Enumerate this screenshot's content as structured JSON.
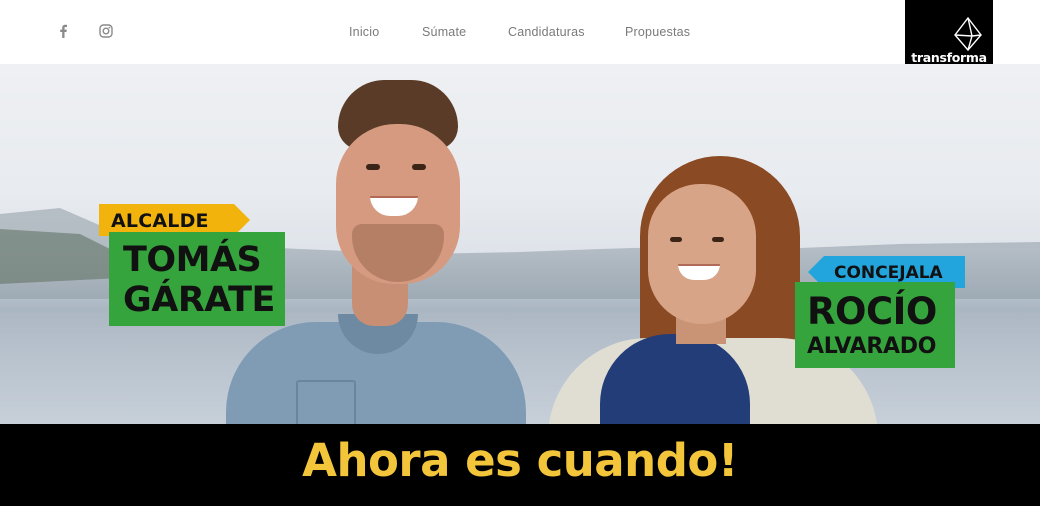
{
  "header": {
    "social": [
      {
        "icon": "facebook-icon",
        "glyph": "f"
      },
      {
        "icon": "instagram-icon"
      }
    ],
    "nav": [
      {
        "label": "Inicio"
      },
      {
        "label": "Súmate"
      },
      {
        "label": "Candidaturas"
      },
      {
        "label": "Propuestas"
      }
    ],
    "logo": {
      "text": "transforma",
      "icon": "diamond-logo-icon"
    }
  },
  "hero": {
    "candidate_1": {
      "role": "ALCALDE",
      "name_line1": "TOMÁS",
      "name_line2": "GÁRATE",
      "role_color": "#f2b40c"
    },
    "candidate_2": {
      "role": "CONCEJALA",
      "name_line1": "ROCÍO",
      "name_line2": "ALVARADO",
      "role_color": "#22a4dc"
    },
    "name_box_color": "#36a43d"
  },
  "banner": {
    "headline": "Ahora es cuando!",
    "color": "#f3c53b"
  }
}
